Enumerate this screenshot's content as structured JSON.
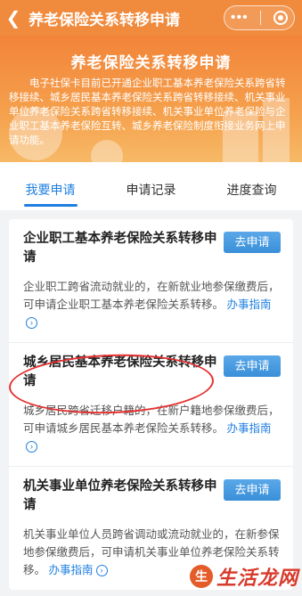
{
  "navbar": {
    "title": "养老保险关系转移申请"
  },
  "banner": {
    "title": "养老保险关系转移申请",
    "description": "电子社保卡目前已开通企业职工基本养老保险关系跨省转移接续、城乡居民基本养老保险关系跨省转移接续、机关事业单位养老保险关系跨省转移接续、机关事业单位养老保险与企业职工基本养老保险互转、城乡养老保险制度衔接业务网上申请功能。"
  },
  "tabs": [
    {
      "label": "我要申请"
    },
    {
      "label": "申请记录"
    },
    {
      "label": "进度查询"
    }
  ],
  "cards": [
    {
      "title": "企业职工基本养老保险关系转移申请",
      "button": "去申请",
      "desc": "企业职工跨省流动就业的，在新就业地参保缴费后，可申请企业职工基本养老保险关系转移。",
      "guide": "办事指南"
    },
    {
      "title": "城乡居民基本养老保险关系转移申请",
      "button": "去申请",
      "desc": "城乡居民跨省迁移户籍的，在新户籍地参保缴费后，可申请城乡居民基本养老保险关系转移。",
      "guide": "办事指南"
    },
    {
      "title": "机关事业单位养老保险关系转移申请",
      "button": "去申请",
      "desc": "机关事业单位人员跨省调动或流动就业的，在新参保地参保缴费后，可申请机关事业单位养老保险关系转移。",
      "guide": "办事指南"
    }
  ],
  "watermark": {
    "text": "生活龙网"
  },
  "colors": {
    "header": "#f08a3c",
    "accent": "#1f7fe0",
    "highlight": "#e53030"
  }
}
